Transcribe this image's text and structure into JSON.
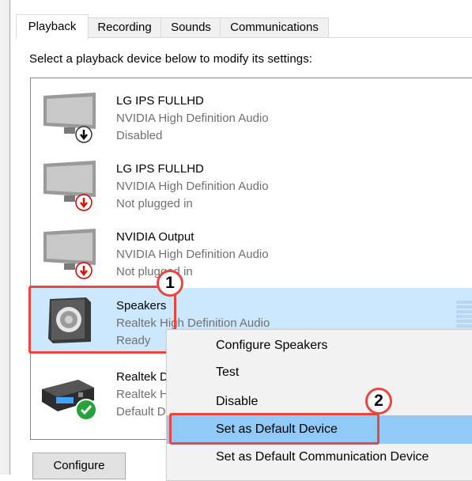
{
  "tabs": [
    "Playback",
    "Recording",
    "Sounds",
    "Communications"
  ],
  "instruction": "Select a playback device below to modify its settings:",
  "devices": [
    {
      "name": "LG IPS FULLHD",
      "driver": "NVIDIA High Definition Audio",
      "status": "Disabled",
      "icon": "monitor-icon",
      "overlay": "down-arrow-black"
    },
    {
      "name": "LG IPS FULLHD",
      "driver": "NVIDIA High Definition Audio",
      "status": "Not plugged in",
      "icon": "monitor-icon",
      "overlay": "down-arrow-red"
    },
    {
      "name": "NVIDIA Output",
      "driver": "NVIDIA High Definition Audio",
      "status": "Not plugged in",
      "icon": "monitor-icon",
      "overlay": "down-arrow-red"
    },
    {
      "name": "Speakers",
      "driver": "Realtek High Definition Audio",
      "status": "Ready",
      "icon": "speaker-icon",
      "selected": true
    },
    {
      "name": "Realtek Digital Output",
      "driver": "Realtek High Definition Audio",
      "status": "Default Device",
      "icon": "digital-output-icon",
      "overlay": "green-check"
    }
  ],
  "context_menu": [
    "Configure Speakers",
    "Test",
    "Disable",
    "Set as Default Device",
    "Set as Default Communication Device"
  ],
  "callouts": [
    "1",
    "2"
  ],
  "configure_button": "Configure",
  "colors": {
    "selection": "#cce8ff",
    "menu_highlight": "#91c9f7",
    "annotation_red": "#e8463e"
  }
}
